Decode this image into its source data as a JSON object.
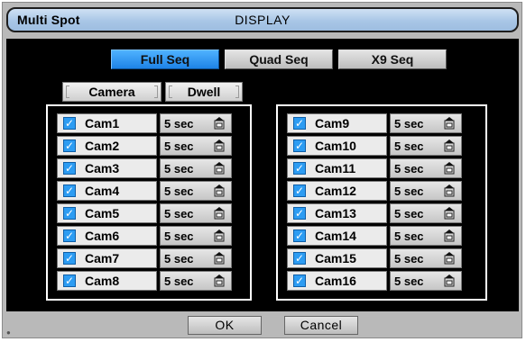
{
  "window": {
    "title": "Multi Spot",
    "heading": "DISPLAY"
  },
  "tabs": [
    {
      "label": "Full Seq",
      "active": true
    },
    {
      "label": "Quad Seq",
      "active": false
    },
    {
      "label": "X9 Seq",
      "active": false
    }
  ],
  "columns": {
    "camera": "Camera",
    "dwell": "Dwell"
  },
  "group_left": [
    {
      "cam": "Cam1",
      "dwell": "5 sec",
      "checked": true
    },
    {
      "cam": "Cam2",
      "dwell": "5 sec",
      "checked": true
    },
    {
      "cam": "Cam3",
      "dwell": "5 sec",
      "checked": true
    },
    {
      "cam": "Cam4",
      "dwell": "5 sec",
      "checked": true
    },
    {
      "cam": "Cam5",
      "dwell": "5 sec",
      "checked": true
    },
    {
      "cam": "Cam6",
      "dwell": "5 sec",
      "checked": true
    },
    {
      "cam": "Cam7",
      "dwell": "5 sec",
      "checked": true
    },
    {
      "cam": "Cam8",
      "dwell": "5 sec",
      "checked": true
    }
  ],
  "group_right": [
    {
      "cam": "Cam9",
      "dwell": "5 sec",
      "checked": true
    },
    {
      "cam": "Cam10",
      "dwell": "5 sec",
      "checked": true
    },
    {
      "cam": "Cam11",
      "dwell": "5 sec",
      "checked": true
    },
    {
      "cam": "Cam12",
      "dwell": "5 sec",
      "checked": true
    },
    {
      "cam": "Cam13",
      "dwell": "5 sec",
      "checked": true
    },
    {
      "cam": "Cam14",
      "dwell": "5 sec",
      "checked": true
    },
    {
      "cam": "Cam15",
      "dwell": "5 sec",
      "checked": true
    },
    {
      "cam": "Cam16",
      "dwell": "5 sec",
      "checked": true
    }
  ],
  "buttons": {
    "ok": "OK",
    "cancel": "Cancel"
  },
  "colors": {
    "accent": "#2d9cf2",
    "title_bar": "#a9c6e6",
    "panel": "#000000"
  }
}
